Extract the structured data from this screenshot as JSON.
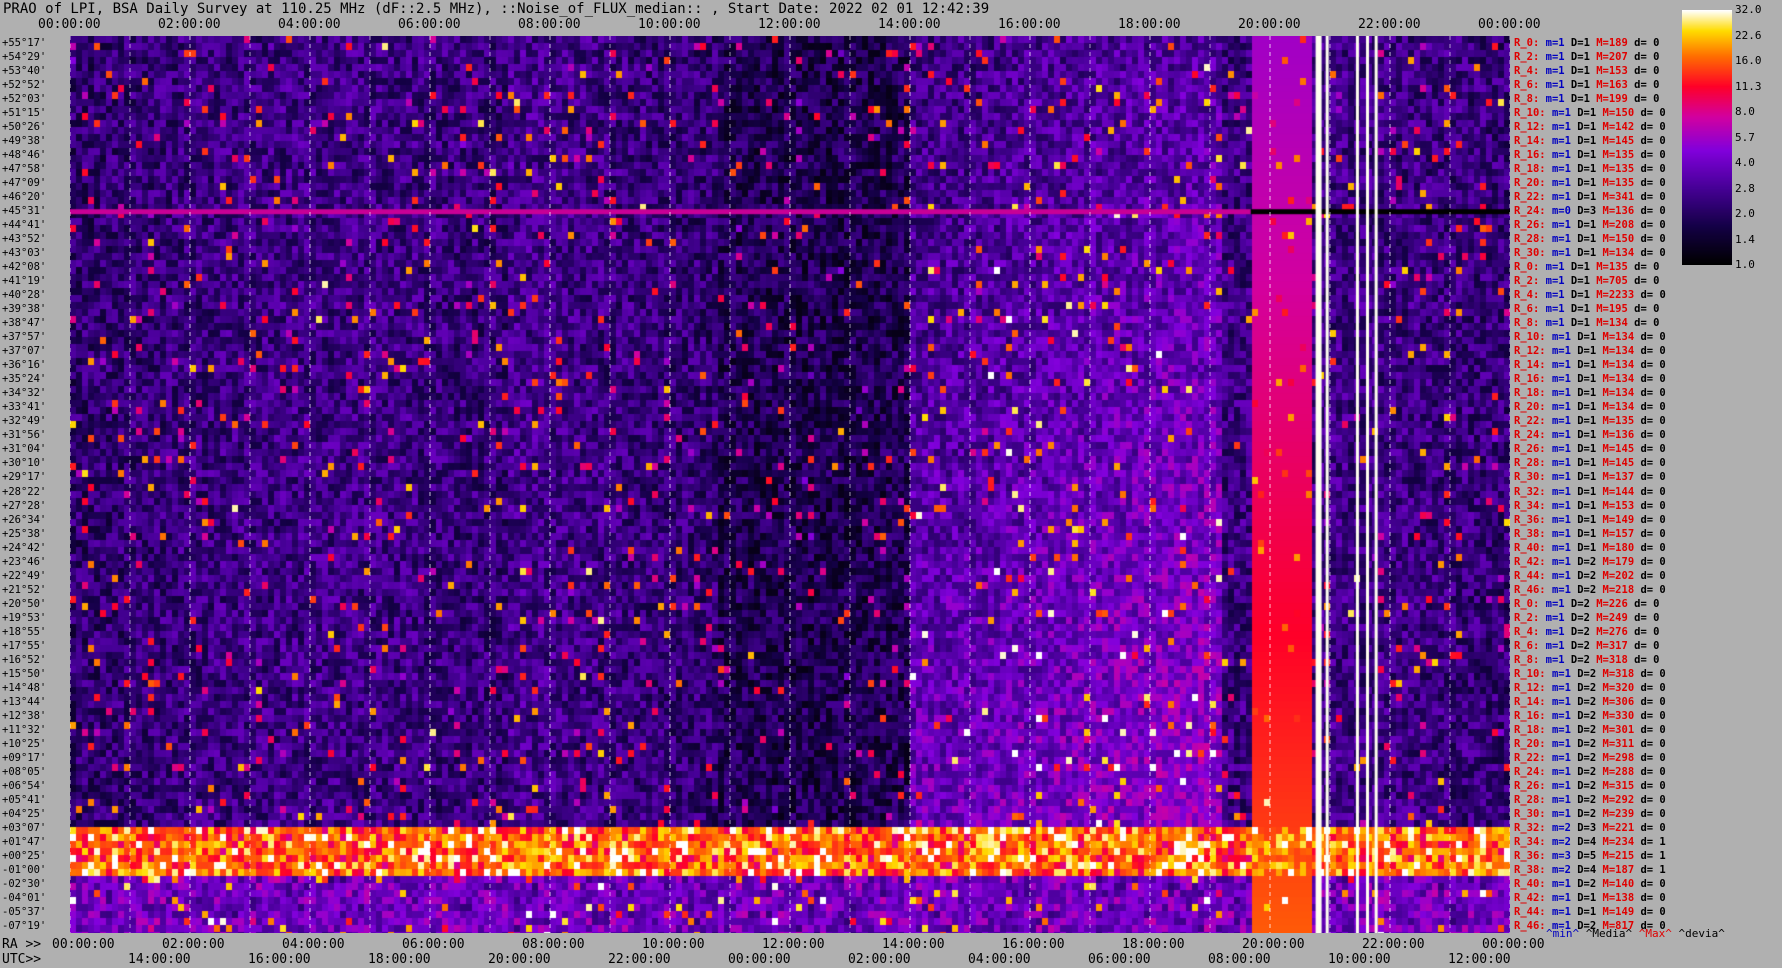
{
  "title": "PRAO of LPI, BSA Daily Survey at 110.25 MHz (dF::2.5 MHz), ::Noise_of_FLUX_median:: , Start Date: 2022 02 01 12:42:39",
  "axis_prefix_ra": "RA >>",
  "axis_prefix_utc": "UTC>>",
  "chart_data": {
    "type": "heatmap",
    "title": "PRAO of LPI, BSA Daily Survey at 110.25 MHz (dF::2.5 MHz), ::Noise_of_FLUX_median:: , Start Date: 2022 02 01 12:42:39",
    "x_top_ticks": [
      "00:00:00",
      "02:00:00",
      "04:00:00",
      "06:00:00",
      "08:00:00",
      "10:00:00",
      "12:00:00",
      "14:00:00",
      "16:00:00",
      "18:00:00",
      "20:00:00",
      "22:00:00",
      "00:00:00"
    ],
    "x_bottom_ra_ticks": [
      "00:00:00",
      "02:00:00",
      "04:00:00",
      "06:00:00",
      "08:00:00",
      "10:00:00",
      "12:00:00",
      "14:00:00",
      "16:00:00",
      "18:00:00",
      "20:00:00",
      "22:00:00",
      "00:00:00"
    ],
    "x_bottom_utc_ticks": [
      "14:00:00",
      "16:00:00",
      "18:00:00",
      "20:00:00",
      "22:00:00",
      "00:00:00",
      "02:00:00",
      "04:00:00",
      "06:00:00",
      "08:00:00",
      "10:00:00",
      "12:00:00"
    ],
    "colorbar": {
      "ticks": [
        "32.0",
        "22.6",
        "16.0",
        "11.3",
        "8.0",
        "5.7",
        "4.0",
        "2.8",
        "2.0",
        "1.4",
        "1.0"
      ],
      "scale": "log",
      "range": [
        1.0,
        32.0
      ]
    },
    "declinations": [
      "+55°17'",
      "+54°29'",
      "+53°40'",
      "+52°52'",
      "+52°03'",
      "+51°15'",
      "+50°26'",
      "+49°38'",
      "+48°46'",
      "+47°58'",
      "+47°09'",
      "+46°20'",
      "+45°31'",
      "+44°41'",
      "+43°52'",
      "+43°03'",
      "+42°08'",
      "+41°19'",
      "+40°28'",
      "+39°38'",
      "+38°47'",
      "+37°57'",
      "+37°07'",
      "+36°16'",
      "+35°24'",
      "+34°32'",
      "+33°41'",
      "+32°49'",
      "+31°56'",
      "+31°04'",
      "+30°10'",
      "+29°17'",
      "+28°22'",
      "+27°28'",
      "+26°34'",
      "+25°38'",
      "+24°42'",
      "+23°46'",
      "+22°49'",
      "+21°52'",
      "+20°50'",
      "+19°53'",
      "+18°55'",
      "+17°55'",
      "+16°52'",
      "+15°50'",
      "+14°48'",
      "+13°44'",
      "+12°38'",
      "+11°32'",
      "+10°25'",
      "+09°17'",
      "+08°05'",
      "+06°54'",
      "+05°41'",
      "+04°25'",
      "+03°07'",
      "+01°47'",
      "+00°25'",
      "-01°00'",
      "-02°30'",
      "-04°01'",
      "-05°37'",
      "-07°19'"
    ],
    "row_stats": [
      {
        "r": "R_0:",
        "m": "m=1",
        "d": "D=1",
        "max": "M=189",
        "dev": "d= 0"
      },
      {
        "r": "R_2:",
        "m": "m=1",
        "d": "D=1",
        "max": "M=207",
        "dev": "d= 0"
      },
      {
        "r": "R_4:",
        "m": "m=1",
        "d": "D=1",
        "max": "M=153",
        "dev": "d= 0"
      },
      {
        "r": "R_6:",
        "m": "m=1",
        "d": "D=1",
        "max": "M=163",
        "dev": "d= 0"
      },
      {
        "r": "R_8:",
        "m": "m=1",
        "d": "D=1",
        "max": "M=199",
        "dev": "d= 0"
      },
      {
        "r": "R_10:",
        "m": "m=1",
        "d": "D=1",
        "max": "M=150",
        "dev": "d= 0"
      },
      {
        "r": "R_12:",
        "m": "m=1",
        "d": "D=1",
        "max": "M=142",
        "dev": "d= 0"
      },
      {
        "r": "R_14:",
        "m": "m=1",
        "d": "D=1",
        "max": "M=145",
        "dev": "d= 0"
      },
      {
        "r": "R_16:",
        "m": "m=1",
        "d": "D=1",
        "max": "M=135",
        "dev": "d= 0"
      },
      {
        "r": "R_18:",
        "m": "m=1",
        "d": "D=1",
        "max": "M=135",
        "dev": "d= 0"
      },
      {
        "r": "R_20:",
        "m": "m=1",
        "d": "D=1",
        "max": "M=135",
        "dev": "d= 0"
      },
      {
        "r": "R_22:",
        "m": "m=1",
        "d": "D=1",
        "max": "M=341",
        "dev": "d= 0"
      },
      {
        "r": "R_24:",
        "m": "m=0",
        "d": "D=3",
        "max": "M=136",
        "dev": "d= 0"
      },
      {
        "r": "R_26:",
        "m": "m=1",
        "d": "D=1",
        "max": "M=208",
        "dev": "d= 0"
      },
      {
        "r": "R_28:",
        "m": "m=1",
        "d": "D=1",
        "max": "M=150",
        "dev": "d= 0"
      },
      {
        "r": "R_30:",
        "m": "m=1",
        "d": "D=1",
        "max": "M=134",
        "dev": "d= 0"
      },
      {
        "r": "R_0:",
        "m": "m=1",
        "d": "D=1",
        "max": "M=135",
        "dev": "d= 0"
      },
      {
        "r": "R_2:",
        "m": "m=1",
        "d": "D=1",
        "max": "M=705",
        "dev": "d= 0"
      },
      {
        "r": "R_4:",
        "m": "m=1",
        "d": "D=1",
        "max": "M=2233",
        "dev": "d= 0"
      },
      {
        "r": "R_6:",
        "m": "m=1",
        "d": "D=1",
        "max": "M=195",
        "dev": "d= 0"
      },
      {
        "r": "R_8:",
        "m": "m=1",
        "d": "D=1",
        "max": "M=134",
        "dev": "d= 0"
      },
      {
        "r": "R_10:",
        "m": "m=1",
        "d": "D=1",
        "max": "M=134",
        "dev": "d= 0"
      },
      {
        "r": "R_12:",
        "m": "m=1",
        "d": "D=1",
        "max": "M=134",
        "dev": "d= 0"
      },
      {
        "r": "R_14:",
        "m": "m=1",
        "d": "D=1",
        "max": "M=134",
        "dev": "d= 0"
      },
      {
        "r": "R_16:",
        "m": "m=1",
        "d": "D=1",
        "max": "M=134",
        "dev": "d= 0"
      },
      {
        "r": "R_18:",
        "m": "m=1",
        "d": "D=1",
        "max": "M=134",
        "dev": "d= 0"
      },
      {
        "r": "R_20:",
        "m": "m=1",
        "d": "D=1",
        "max": "M=134",
        "dev": "d= 0"
      },
      {
        "r": "R_22:",
        "m": "m=1",
        "d": "D=1",
        "max": "M=135",
        "dev": "d= 0"
      },
      {
        "r": "R_24:",
        "m": "m=1",
        "d": "D=1",
        "max": "M=136",
        "dev": "d= 0"
      },
      {
        "r": "R_26:",
        "m": "m=1",
        "d": "D=1",
        "max": "M=145",
        "dev": "d= 0"
      },
      {
        "r": "R_28:",
        "m": "m=1",
        "d": "D=1",
        "max": "M=145",
        "dev": "d= 0"
      },
      {
        "r": "R_30:",
        "m": "m=1",
        "d": "D=1",
        "max": "M=137",
        "dev": "d= 0"
      },
      {
        "r": "R_32:",
        "m": "m=1",
        "d": "D=1",
        "max": "M=144",
        "dev": "d= 0"
      },
      {
        "r": "R_34:",
        "m": "m=1",
        "d": "D=1",
        "max": "M=153",
        "dev": "d= 0"
      },
      {
        "r": "R_36:",
        "m": "m=1",
        "d": "D=1",
        "max": "M=149",
        "dev": "d= 0"
      },
      {
        "r": "R_38:",
        "m": "m=1",
        "d": "D=1",
        "max": "M=157",
        "dev": "d= 0"
      },
      {
        "r": "R_40:",
        "m": "m=1",
        "d": "D=1",
        "max": "M=180",
        "dev": "d= 0"
      },
      {
        "r": "R_42:",
        "m": "m=1",
        "d": "D=2",
        "max": "M=179",
        "dev": "d= 0"
      },
      {
        "r": "R_44:",
        "m": "m=1",
        "d": "D=2",
        "max": "M=202",
        "dev": "d= 0"
      },
      {
        "r": "R_46:",
        "m": "m=1",
        "d": "D=2",
        "max": "M=218",
        "dev": "d= 0"
      },
      {
        "r": "R_0:",
        "m": "m=1",
        "d": "D=2",
        "max": "M=226",
        "dev": "d= 0"
      },
      {
        "r": "R_2:",
        "m": "m=1",
        "d": "D=2",
        "max": "M=249",
        "dev": "d= 0"
      },
      {
        "r": "R_4:",
        "m": "m=1",
        "d": "D=2",
        "max": "M=276",
        "dev": "d= 0"
      },
      {
        "r": "R_6:",
        "m": "m=1",
        "d": "D=2",
        "max": "M=317",
        "dev": "d= 0"
      },
      {
        "r": "R_8:",
        "m": "m=1",
        "d": "D=2",
        "max": "M=318",
        "dev": "d= 0"
      },
      {
        "r": "R_10:",
        "m": "m=1",
        "d": "D=2",
        "max": "M=318",
        "dev": "d= 0"
      },
      {
        "r": "R_12:",
        "m": "m=1",
        "d": "D=2",
        "max": "M=320",
        "dev": "d= 0"
      },
      {
        "r": "R_14:",
        "m": "m=1",
        "d": "D=2",
        "max": "M=306",
        "dev": "d= 0"
      },
      {
        "r": "R_16:",
        "m": "m=1",
        "d": "D=2",
        "max": "M=330",
        "dev": "d= 0"
      },
      {
        "r": "R_18:",
        "m": "m=1",
        "d": "D=2",
        "max": "M=301",
        "dev": "d= 0"
      },
      {
        "r": "R_20:",
        "m": "m=1",
        "d": "D=2",
        "max": "M=311",
        "dev": "d= 0"
      },
      {
        "r": "R_22:",
        "m": "m=1",
        "d": "D=2",
        "max": "M=298",
        "dev": "d= 0"
      },
      {
        "r": "R_24:",
        "m": "m=1",
        "d": "D=2",
        "max": "M=288",
        "dev": "d= 0"
      },
      {
        "r": "R_26:",
        "m": "m=1",
        "d": "D=2",
        "max": "M=315",
        "dev": "d= 0"
      },
      {
        "r": "R_28:",
        "m": "m=1",
        "d": "D=2",
        "max": "M=292",
        "dev": "d= 0"
      },
      {
        "r": "R_30:",
        "m": "m=1",
        "d": "D=2",
        "max": "M=239",
        "dev": "d= 0"
      },
      {
        "r": "R_32:",
        "m": "m=2",
        "d": "D=3",
        "max": "M=221",
        "dev": "d= 0"
      },
      {
        "r": "R_34:",
        "m": "m=2",
        "d": "D=4",
        "max": "M=234",
        "dev": "d= 1"
      },
      {
        "r": "R_36:",
        "m": "m=3",
        "d": "D=5",
        "max": "M=215",
        "dev": "d= 1"
      },
      {
        "r": "R_38:",
        "m": "m=2",
        "d": "D=4",
        "max": "M=187",
        "dev": "d= 1"
      },
      {
        "r": "R_40:",
        "m": "m=1",
        "d": "D=2",
        "max": "M=140",
        "dev": "d= 0"
      },
      {
        "r": "R_42:",
        "m": "m=1",
        "d": "D=1",
        "max": "M=138",
        "dev": "d= 0"
      },
      {
        "r": "R_44:",
        "m": "m=1",
        "d": "D=1",
        "max": "M=149",
        "dev": "d= 0"
      },
      {
        "r": "R_46:",
        "m": "m=1",
        "d": "D=2",
        "max": "M=817",
        "dev": "d= 0"
      }
    ]
  },
  "legend": {
    "min": "^min^",
    "median": "^Media^",
    "max": "^Max^",
    "dev": "^devia^"
  }
}
